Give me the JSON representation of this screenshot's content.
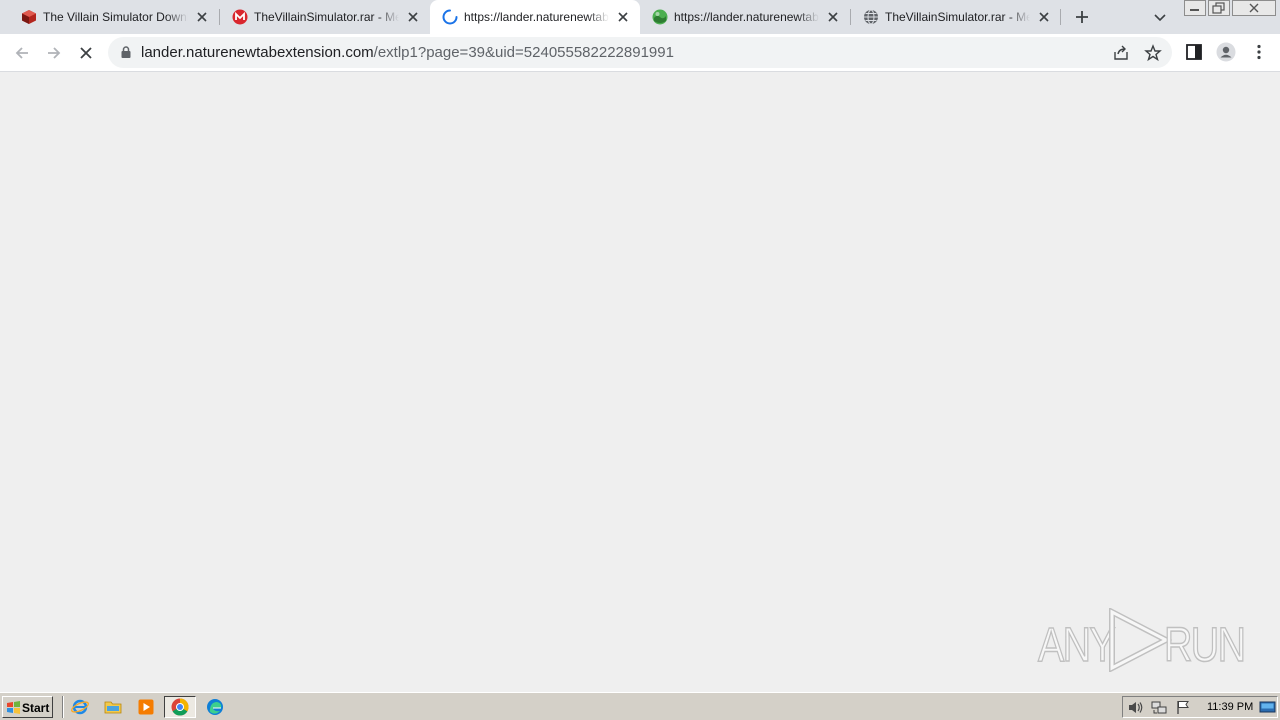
{
  "browser": {
    "tabs": [
      {
        "title": "The Villain Simulator Download",
        "icon": "game-icon",
        "active": false
      },
      {
        "title": "TheVillainSimulator.rar - Mega",
        "icon": "mega-icon",
        "active": false
      },
      {
        "title": "https://lander.naturenewtabe",
        "icon": "loading-spinner-icon",
        "active": true
      },
      {
        "title": "https://lander.naturenewtabe",
        "icon": "nature-globe-icon",
        "active": false
      },
      {
        "title": "TheVillainSimulator.rar - Mega",
        "icon": "globe-icon",
        "active": false
      }
    ],
    "address": {
      "host": "lander.naturenewtabextension.com",
      "path": "/extlp1?page=39&uid=524055582222891991"
    }
  },
  "watermark": {
    "left": "ANY",
    "right": "RUN"
  },
  "taskbar": {
    "start_label": "Start",
    "clock": "11:39 PM",
    "quick_launch": [
      "internet-explorer-icon",
      "file-explorer-icon",
      "media-player-icon",
      "chrome-icon",
      "edge-icon"
    ]
  },
  "colors": {
    "tab_strip": "#dee1e6",
    "page_background": "#efefef",
    "taskbar": "#d4d0c8",
    "spinner": "#1a73e8"
  }
}
